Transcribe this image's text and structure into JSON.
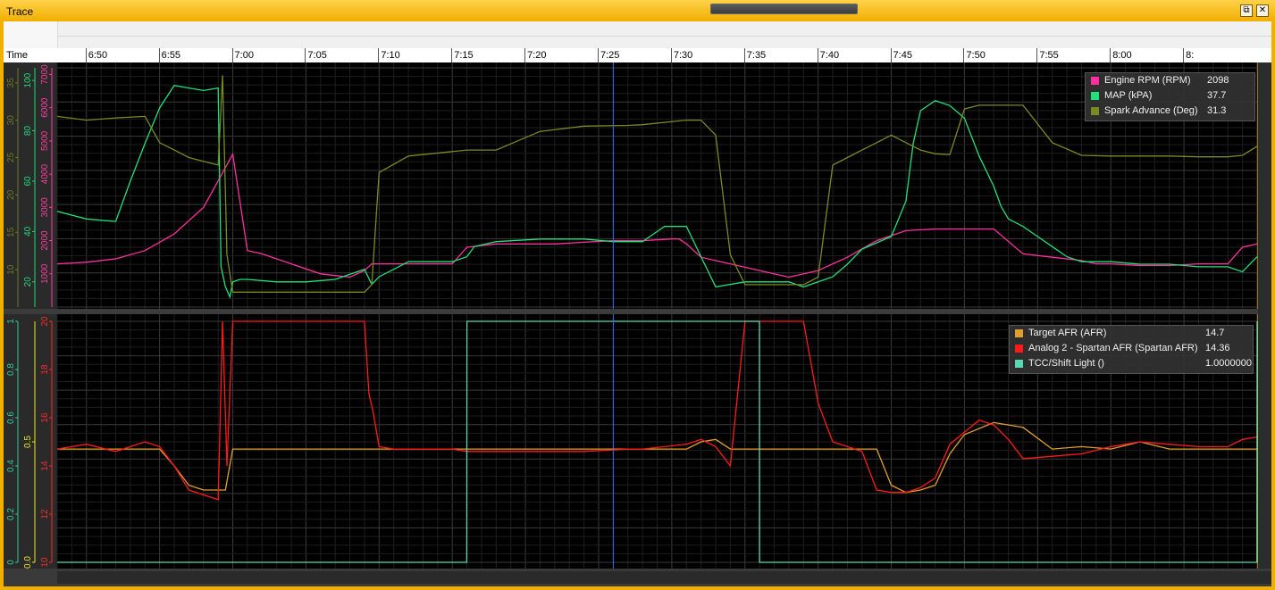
{
  "window": {
    "title": "Trace",
    "restore_glyph": "⧉",
    "close_glyph": "✕"
  },
  "time_axis": {
    "caption": "Time",
    "labels": [
      "6:50",
      "6:55",
      "7:00",
      "7:05",
      "7:10",
      "7:15",
      "7:20",
      "7:25",
      "7:30",
      "7:35",
      "7:40",
      "7:45",
      "7:50",
      "7:55",
      "8:00",
      "8:"
    ]
  },
  "chart_data": [
    {
      "type": "line",
      "x_unit": "time",
      "x_range": [
        "6:48",
        "8:10"
      ],
      "cursor_x": "7:26",
      "axes": [
        {
          "label_color": "#6f7a22",
          "ticks": [
            "10",
            "15",
            "20",
            "25",
            "30",
            "35"
          ],
          "ylim": [
            5,
            37
          ]
        },
        {
          "label_color": "#22d87a",
          "ticks": [
            "20",
            "40",
            "60",
            "80",
            "100"
          ],
          "ylim": [
            10,
            105
          ]
        },
        {
          "label_color": "#ff3ca0",
          "ticks": [
            "1000",
            "2000",
            "3000",
            "4000",
            "5000",
            "6000",
            "7000"
          ],
          "ylim": [
            0,
            7200
          ]
        }
      ],
      "series": [
        {
          "name": "Engine RPM (RPM)",
          "color": "#ff2fa0",
          "axis": 2,
          "legend_value": "2098",
          "x": [
            0,
            2,
            4,
            6,
            8,
            10,
            11,
            11.5,
            12,
            13,
            14,
            16,
            18,
            20,
            21,
            21.5,
            22,
            24,
            27,
            28,
            30,
            32,
            34,
            36,
            38,
            40,
            42,
            42.5,
            43,
            44,
            46,
            48,
            50,
            52,
            52.5,
            53,
            54,
            56,
            58,
            60,
            62,
            64,
            66,
            68,
            70,
            70.5,
            71,
            72,
            74,
            76,
            78,
            80,
            81,
            82
          ],
          "y": [
            1300,
            1350,
            1450,
            1700,
            2200,
            3000,
            3800,
            4200,
            4600,
            1700,
            1600,
            1300,
            1000,
            900,
            1100,
            1300,
            1300,
            1300,
            1300,
            1800,
            1900,
            1900,
            1900,
            1950,
            2000,
            2000,
            2050,
            2050,
            1900,
            1500,
            1300,
            1100,
            900,
            1100,
            1200,
            1300,
            1500,
            2000,
            2300,
            2350,
            2350,
            2350,
            1600,
            1500,
            1400,
            1350,
            1300,
            1300,
            1250,
            1250,
            1300,
            1300,
            1800,
            1900
          ]
        },
        {
          "name": "MAP (kPA)",
          "color": "#22e07a",
          "axis": 1,
          "legend_value": "37.7",
          "x": [
            0,
            2,
            4,
            5,
            6,
            7,
            8,
            9,
            10,
            11,
            11.2,
            11.5,
            11.8,
            12,
            12.5,
            13,
            15,
            17,
            19,
            21,
            21.5,
            22,
            23,
            24,
            27,
            28,
            28.5,
            30,
            33,
            36,
            38,
            40,
            41,
            41.5,
            42,
            43,
            44,
            45,
            47,
            50,
            51,
            52,
            53,
            54,
            55,
            57,
            58,
            58.5,
            59,
            60,
            61,
            62,
            63,
            64,
            64.5,
            65,
            66,
            67,
            68,
            69,
            70,
            72,
            74,
            76,
            78,
            80,
            81,
            82
          ],
          "y": [
            48,
            45,
            44,
            60,
            75,
            89,
            98,
            97,
            96,
            97,
            26,
            18,
            14,
            20,
            21,
            21,
            20,
            20,
            21,
            25,
            19,
            22,
            25,
            28,
            28,
            30,
            34,
            36,
            37,
            37,
            36,
            36,
            40,
            42,
            42,
            42,
            30,
            18,
            20,
            20,
            18,
            20,
            22,
            27,
            33,
            38,
            52,
            75,
            88,
            92,
            90,
            85,
            70,
            58,
            50,
            45,
            42,
            38,
            34,
            30,
            28,
            28,
            27,
            27,
            26,
            26,
            24,
            30
          ]
        },
        {
          "name": "Spark Advance (Deg)",
          "color": "#7a8a22",
          "axis": 0,
          "legend_value": "31.3",
          "x": [
            0,
            2,
            4,
            6,
            7,
            8,
            9,
            10,
            11,
            11.3,
            11.6,
            12,
            13,
            15,
            17,
            19,
            21,
            21.5,
            22,
            24,
            27,
            28,
            30,
            33,
            36,
            39,
            40,
            43,
            44,
            45,
            46,
            47,
            50,
            51,
            52,
            53,
            54,
            55,
            56,
            57,
            58,
            59,
            60,
            61,
            62,
            63,
            64,
            66,
            68,
            70,
            72,
            74,
            76,
            78,
            80,
            81,
            82
          ],
          "y": [
            30.5,
            30,
            30.3,
            30.5,
            27,
            26,
            25,
            24.5,
            24,
            36,
            12,
            7,
            7,
            7,
            7,
            7,
            7,
            8,
            23,
            25.2,
            25.8,
            26,
            26,
            28.5,
            29.2,
            29.3,
            29.4,
            30,
            30,
            28,
            12,
            8,
            8,
            8,
            9,
            24,
            25,
            26,
            27,
            28,
            27,
            26,
            25.5,
            25.4,
            31.5,
            32,
            32,
            32,
            27,
            25.3,
            25.2,
            25.2,
            25.2,
            25.1,
            25.1,
            25.3,
            26.5
          ]
        }
      ]
    },
    {
      "type": "line",
      "x_unit": "time",
      "x_range": [
        "6:48",
        "8:10"
      ],
      "cursor_x": "7:26",
      "axes": [
        {
          "label_color": "#32c8a0",
          "ticks": [
            "0",
            "0.2",
            "0.4",
            "0.6",
            "0.8",
            "1"
          ],
          "ylim": [
            0,
            1
          ]
        },
        {
          "label_color": "#e8e828",
          "ticks": [
            "0.0",
            "0.5"
          ],
          "ylim": [
            0,
            1
          ]
        },
        {
          "label_color": "#ff2828",
          "ticks": [
            "10",
            "12",
            "14",
            "16",
            "18",
            "20"
          ],
          "ylim": [
            10,
            20
          ]
        }
      ],
      "series": [
        {
          "name": "Target AFR (AFR)",
          "color": "#e0a030",
          "axis": 2,
          "legend_value": "14.7",
          "x": [
            0,
            7,
            8,
            9,
            10,
            11,
            11.5,
            12,
            40,
            43,
            44,
            45,
            46,
            47,
            50,
            54,
            55,
            56,
            57,
            58,
            59,
            60,
            61,
            62,
            64,
            66,
            68,
            70,
            72,
            74,
            76,
            78,
            80,
            82
          ],
          "y": [
            14.7,
            14.7,
            14,
            13.2,
            13,
            13,
            13,
            14.7,
            14.7,
            14.7,
            15,
            15.1,
            14.7,
            14.7,
            14.7,
            14.7,
            14.7,
            14.7,
            13.2,
            12.9,
            13,
            13.2,
            14.5,
            15.3,
            15.8,
            15.6,
            14.7,
            14.8,
            14.7,
            15,
            14.7,
            14.7,
            14.7,
            14.7
          ]
        },
        {
          "name": "Analog 2 - Spartan AFR (Spartan AFR)",
          "color": "#ff1a1a",
          "axis": 2,
          "legend_value": "14.36",
          "x": [
            0,
            2,
            4,
            6,
            7,
            8,
            9,
            10,
            11,
            11.3,
            11.6,
            12,
            12.4,
            12.8,
            13,
            15,
            17,
            19,
            21,
            21.3,
            21.6,
            22,
            23,
            24,
            27,
            28,
            30,
            33,
            36,
            39,
            40,
            43,
            44,
            45,
            46,
            47,
            49,
            50,
            51,
            52,
            53,
            54,
            55,
            56,
            57,
            58,
            59,
            60,
            61,
            62,
            63,
            64,
            65,
            66,
            68,
            70,
            72,
            74,
            76,
            78,
            80,
            81,
            82
          ],
          "y": [
            14.7,
            14.9,
            14.6,
            15,
            14.8,
            14,
            13,
            12.8,
            12.6,
            20,
            14,
            20,
            20,
            20,
            20,
            20,
            20,
            20,
            20,
            17,
            16.2,
            14.8,
            14.7,
            14.7,
            14.7,
            14.6,
            14.6,
            14.6,
            14.6,
            14.7,
            14.7,
            14.9,
            15.1,
            14.8,
            14,
            20,
            20,
            20,
            20,
            16.6,
            15,
            14.8,
            14.6,
            13,
            12.9,
            12.9,
            13.1,
            13.5,
            14.9,
            15.4,
            15.9,
            15.7,
            15.1,
            14.3,
            14.4,
            14.5,
            14.8,
            15,
            14.9,
            14.8,
            14.8,
            15.1,
            15.2
          ]
        },
        {
          "name": "TCC/Shift Light ()",
          "color": "#5ad8b4",
          "axis": 0,
          "legend_value": "1.0000000",
          "x": [
            0,
            27.99,
            28,
            47.99,
            48,
            81.99,
            82
          ],
          "y": [
            0,
            0,
            1,
            1,
            0,
            0,
            1
          ]
        }
      ]
    }
  ]
}
